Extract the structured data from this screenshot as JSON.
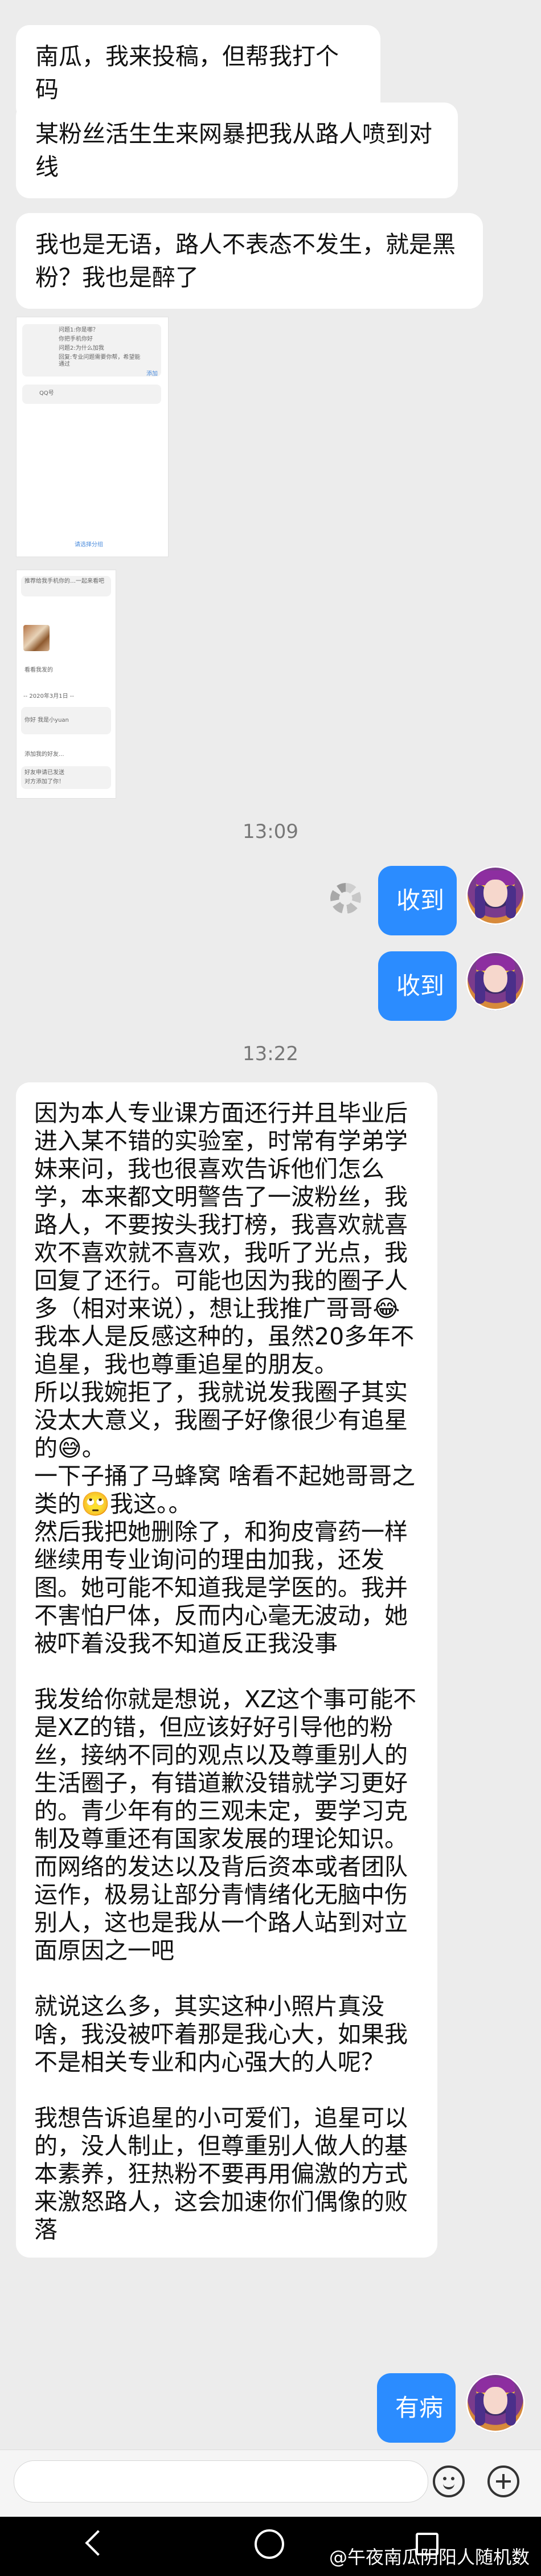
{
  "messages": {
    "m1": "南瓜，我来投稿，但帮我打个码",
    "m2": "某粉丝活生生来网暴把我从路人喷到对线",
    "m3": "我也是无语，路人不表态不发生，就是黑粉？我也是醉了",
    "m4": "因为本人专业课方面还行并且毕业后进入某不错的实验室，时常有学弟学妹来问，我也很喜欢告诉他们怎么学，本来都文明警告了一波粉丝，我路人，不要按头我打榜，我喜欢就喜欢不喜欢就不喜欢，我听了光点，我回复了还行。可能也因为我的圈子人多（相对来说），想让我推广哥哥😂\n我本人是反感这种的，虽然20多年不追星，我也尊重追星的朋友。\n所以我婉拒了，我就说发我圈子其实没太大意义，我圈子好像很少有追星的😅。\n一下子捅了马蜂窝 啥看不起她哥哥之类的🙄我这。。\n然后我把她删除了，和狗皮膏药一样继续用专业询问的理由加我，还发图。她可能不知道我是学医的。我并不害怕尸体，反而内心毫无波动，她被吓着没我不知道反正我没事\n\n我发给你就是想说，XZ这个事可能不是XZ的错，但应该好好引导他的粉丝，接纳不同的观点以及尊重别人的生活圈子，有错道歉没错就学习更好的。青少年有的三观未定，要学习克制及尊重还有国家发展的理论知识。而网络的发达以及背后资本或者团队运作，极易让部分青情绪化无脑中伤别人，这也是我从一个路人站到对立面原因之一吧\n\n就说这么多，其实这种小照片真没啥，我没被吓着那是我心大，如果我不是相关专业和内心强大的人呢？\n\n我想告诉追星的小可爱们，追星可以的，没人制止，但尊重别人做人的基本素养，狂热粉不要再用偏激的方式来激怒路人，这会加速你们偶像的败落"
  },
  "timestamps": {
    "t1": "13:09",
    "t2": "13:22"
  },
  "sent": {
    "s1": "收到",
    "s2": "收到",
    "s3": "有病"
  },
  "screenshot1": {
    "line1": "问题1:你是哪？",
    "line2": "你把手机你好",
    "line3": "问题2:为什么加我",
    "line4": "回复:专业问题需要你帮，希望能通过",
    "line5": "QQ号",
    "button": "添加",
    "footer": "请选择分组"
  },
  "screenshot2": {
    "line1": "推荐给我手机你的…一起来看吧",
    "line2": "看看我发的",
    "line3": "-- 2020年3月1日 --",
    "line4": "你好 我是小yuan",
    "line5": "添加我的好友...",
    "line6": "好友申请已发送",
    "line7": "对方添加了你！"
  },
  "watermark": "@午夜南瓜阴阳人随机数"
}
